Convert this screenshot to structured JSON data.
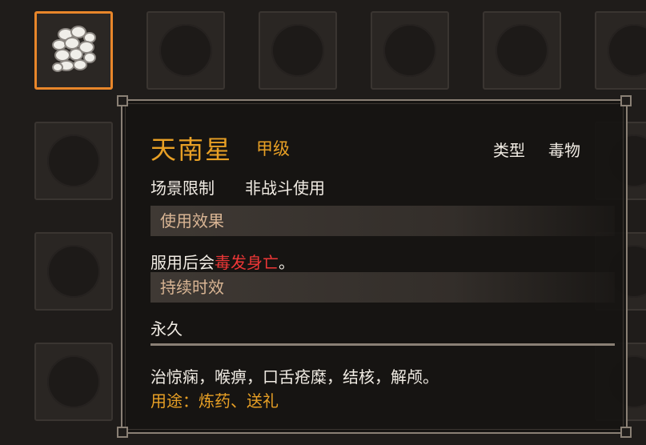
{
  "item": {
    "name": "天南星",
    "grade": "甲级",
    "type_label": "类型",
    "type_value": "毒物",
    "scene_label": "场景限制",
    "scene_value": "非战斗使用",
    "effect_header": "使用效果",
    "effect_prefix": "服用后会",
    "effect_highlight": "毒发身亡",
    "effect_suffix": "。",
    "duration_header": "持续时效",
    "duration_value": "永久",
    "description": "治惊痫，喉痹，口舌疮糜，结核，解颅。",
    "usage_label": "用途：",
    "usage_value": "炼药、送礼",
    "icon": "white-pebbles-icon"
  },
  "colors": {
    "accent_orange": "#e8a025",
    "selection_border": "#e8862a",
    "highlight_red": "#ee3737",
    "text_white": "#f1ece4",
    "section_text": "#d9b594"
  }
}
